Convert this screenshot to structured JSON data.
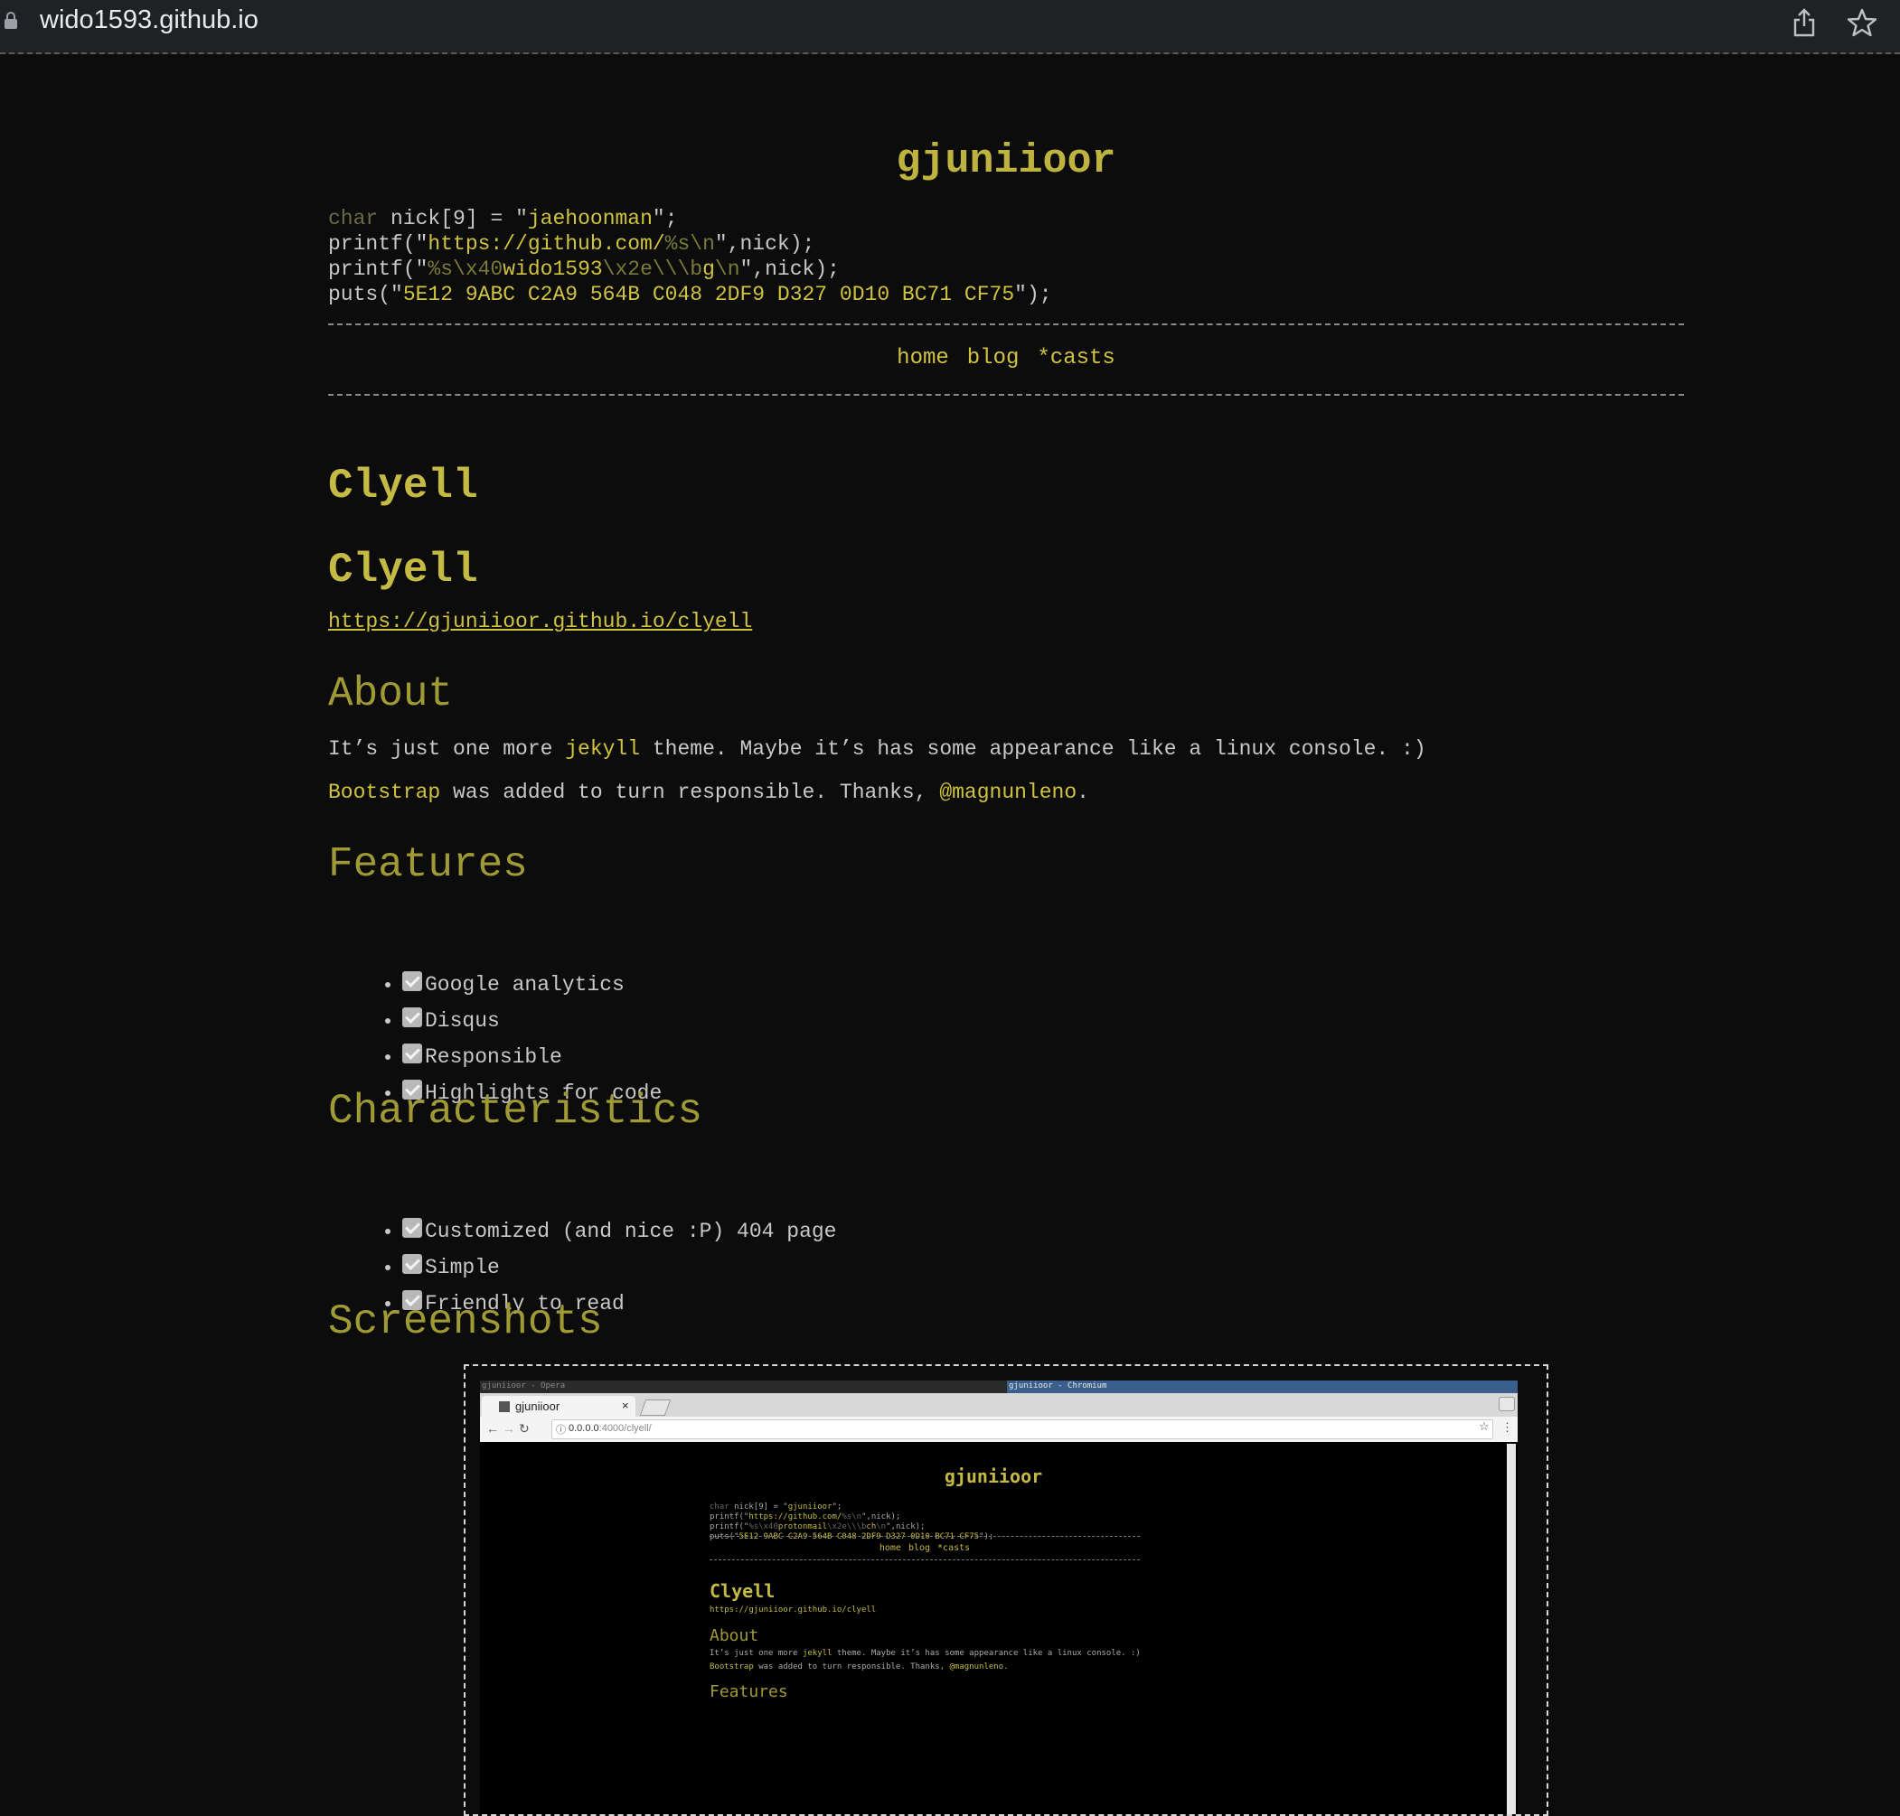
{
  "browser": {
    "url": "wido1593.github.io",
    "icons": [
      "lock-icon",
      "share-icon",
      "star-icon"
    ]
  },
  "site": {
    "title": "gjuniioor",
    "code": {
      "l1_kw": "char",
      "l1_var": " nick[",
      "l1_num": "9",
      "l1_mid": "] = \"",
      "l1_str": "jaehoonman",
      "l1_end": "\";",
      "l2_a": "printf(\"",
      "l2_str": "https://github.com/",
      "l2_esc": "%s\\n",
      "l2_end": "\",nick);",
      "l3_a": "printf(\"",
      "l3_esc1": "%s\\x40",
      "l3_str": "wido1593",
      "l3_esc2": "\\x2e\\\\\\b",
      "l3_str2": "g",
      "l3_esc3": "\\n",
      "l3_end": "\",nick);",
      "l4_a": "puts(\"",
      "l4_str": "5E12 9ABC C2A9 564B C048 2DF9 D327 0D10 BC71 CF75",
      "l4_end": "\");"
    },
    "nav": [
      "home",
      "blog",
      "*casts"
    ]
  },
  "post": {
    "title1": "Clyell",
    "title2": "Clyell",
    "link": "https://gjuniioor.github.io/clyell",
    "about_heading": "About",
    "about_p1_a": "It’s just one more ",
    "about_p1_link": "jekyll",
    "about_p1_b": " theme. Maybe it’s has some appearance like a linux console. :)",
    "about_p2_link1": "Bootstrap",
    "about_p2_a": " was added to turn responsible. Thanks, ",
    "about_p2_link2": "@magnunleno",
    "about_p2_b": ".",
    "features_heading": "Features",
    "features": [
      "Google analytics",
      "Disqus",
      "Responsible",
      "Highlights for code"
    ],
    "characteristics_heading": "Characteristics",
    "characteristics": [
      "Customized (and nice :P) 404 page",
      "Simple",
      "Friendly to read"
    ],
    "screenshots_heading": "Screenshots"
  },
  "screenshot": {
    "titlebar_left": "gjuniioor - Opera",
    "titlebar_right": "gjuniioor - Chromium",
    "tab_title": "gjuniioor",
    "tab_close": "×",
    "url_host": "0.0.0.0",
    "url_path": ":4000/clyell/",
    "page_title": "gjuniioor",
    "code_l1_kw": "char",
    "code_l1_a": " nick[9] = \"",
    "code_l1_str": "gjuniioor",
    "code_l1_end": "\";",
    "code_l2_a": "printf(\"",
    "code_l2_str": "https://github.com/",
    "code_l2_esc": "%s\\n",
    "code_l2_end": "\",nick);",
    "code_l3_a": "printf(\"",
    "code_l3_esc": "%s\\x40",
    "code_l3_str": "protonmail",
    "code_l3_esc2": "\\x2e\\\\\\b",
    "code_l3_str2": "ch",
    "code_l3_esc3": "\\n",
    "code_l3_end": "\",nick);",
    "code_l4_a": "puts(\"",
    "code_l4_str": "5E12 9ABC C2A9 564B C048 2DF9 D327 0D10 BC71 CF75",
    "code_l4_end": "\");",
    "nav": [
      "home",
      "blog",
      "*casts"
    ],
    "post_title": "Clyell",
    "link": "https://gjuniioor.github.io/clyell",
    "about_heading": "About",
    "p1_a": "It’s just one more ",
    "p1_link": "jekyll",
    "p1_b": " theme. Maybe it’s has some appearance like a linux console. :)",
    "p2_link": "Bootstrap",
    "p2_a": " was added to turn responsible. Thanks, ",
    "p2_link2": "@magnunleno",
    "p2_b": ".",
    "features_heading": "Features"
  },
  "colors": {
    "background": "#0c0c0c",
    "accent": "#d0c340",
    "heading": "#a09a36",
    "text": "#c8c8c8"
  }
}
